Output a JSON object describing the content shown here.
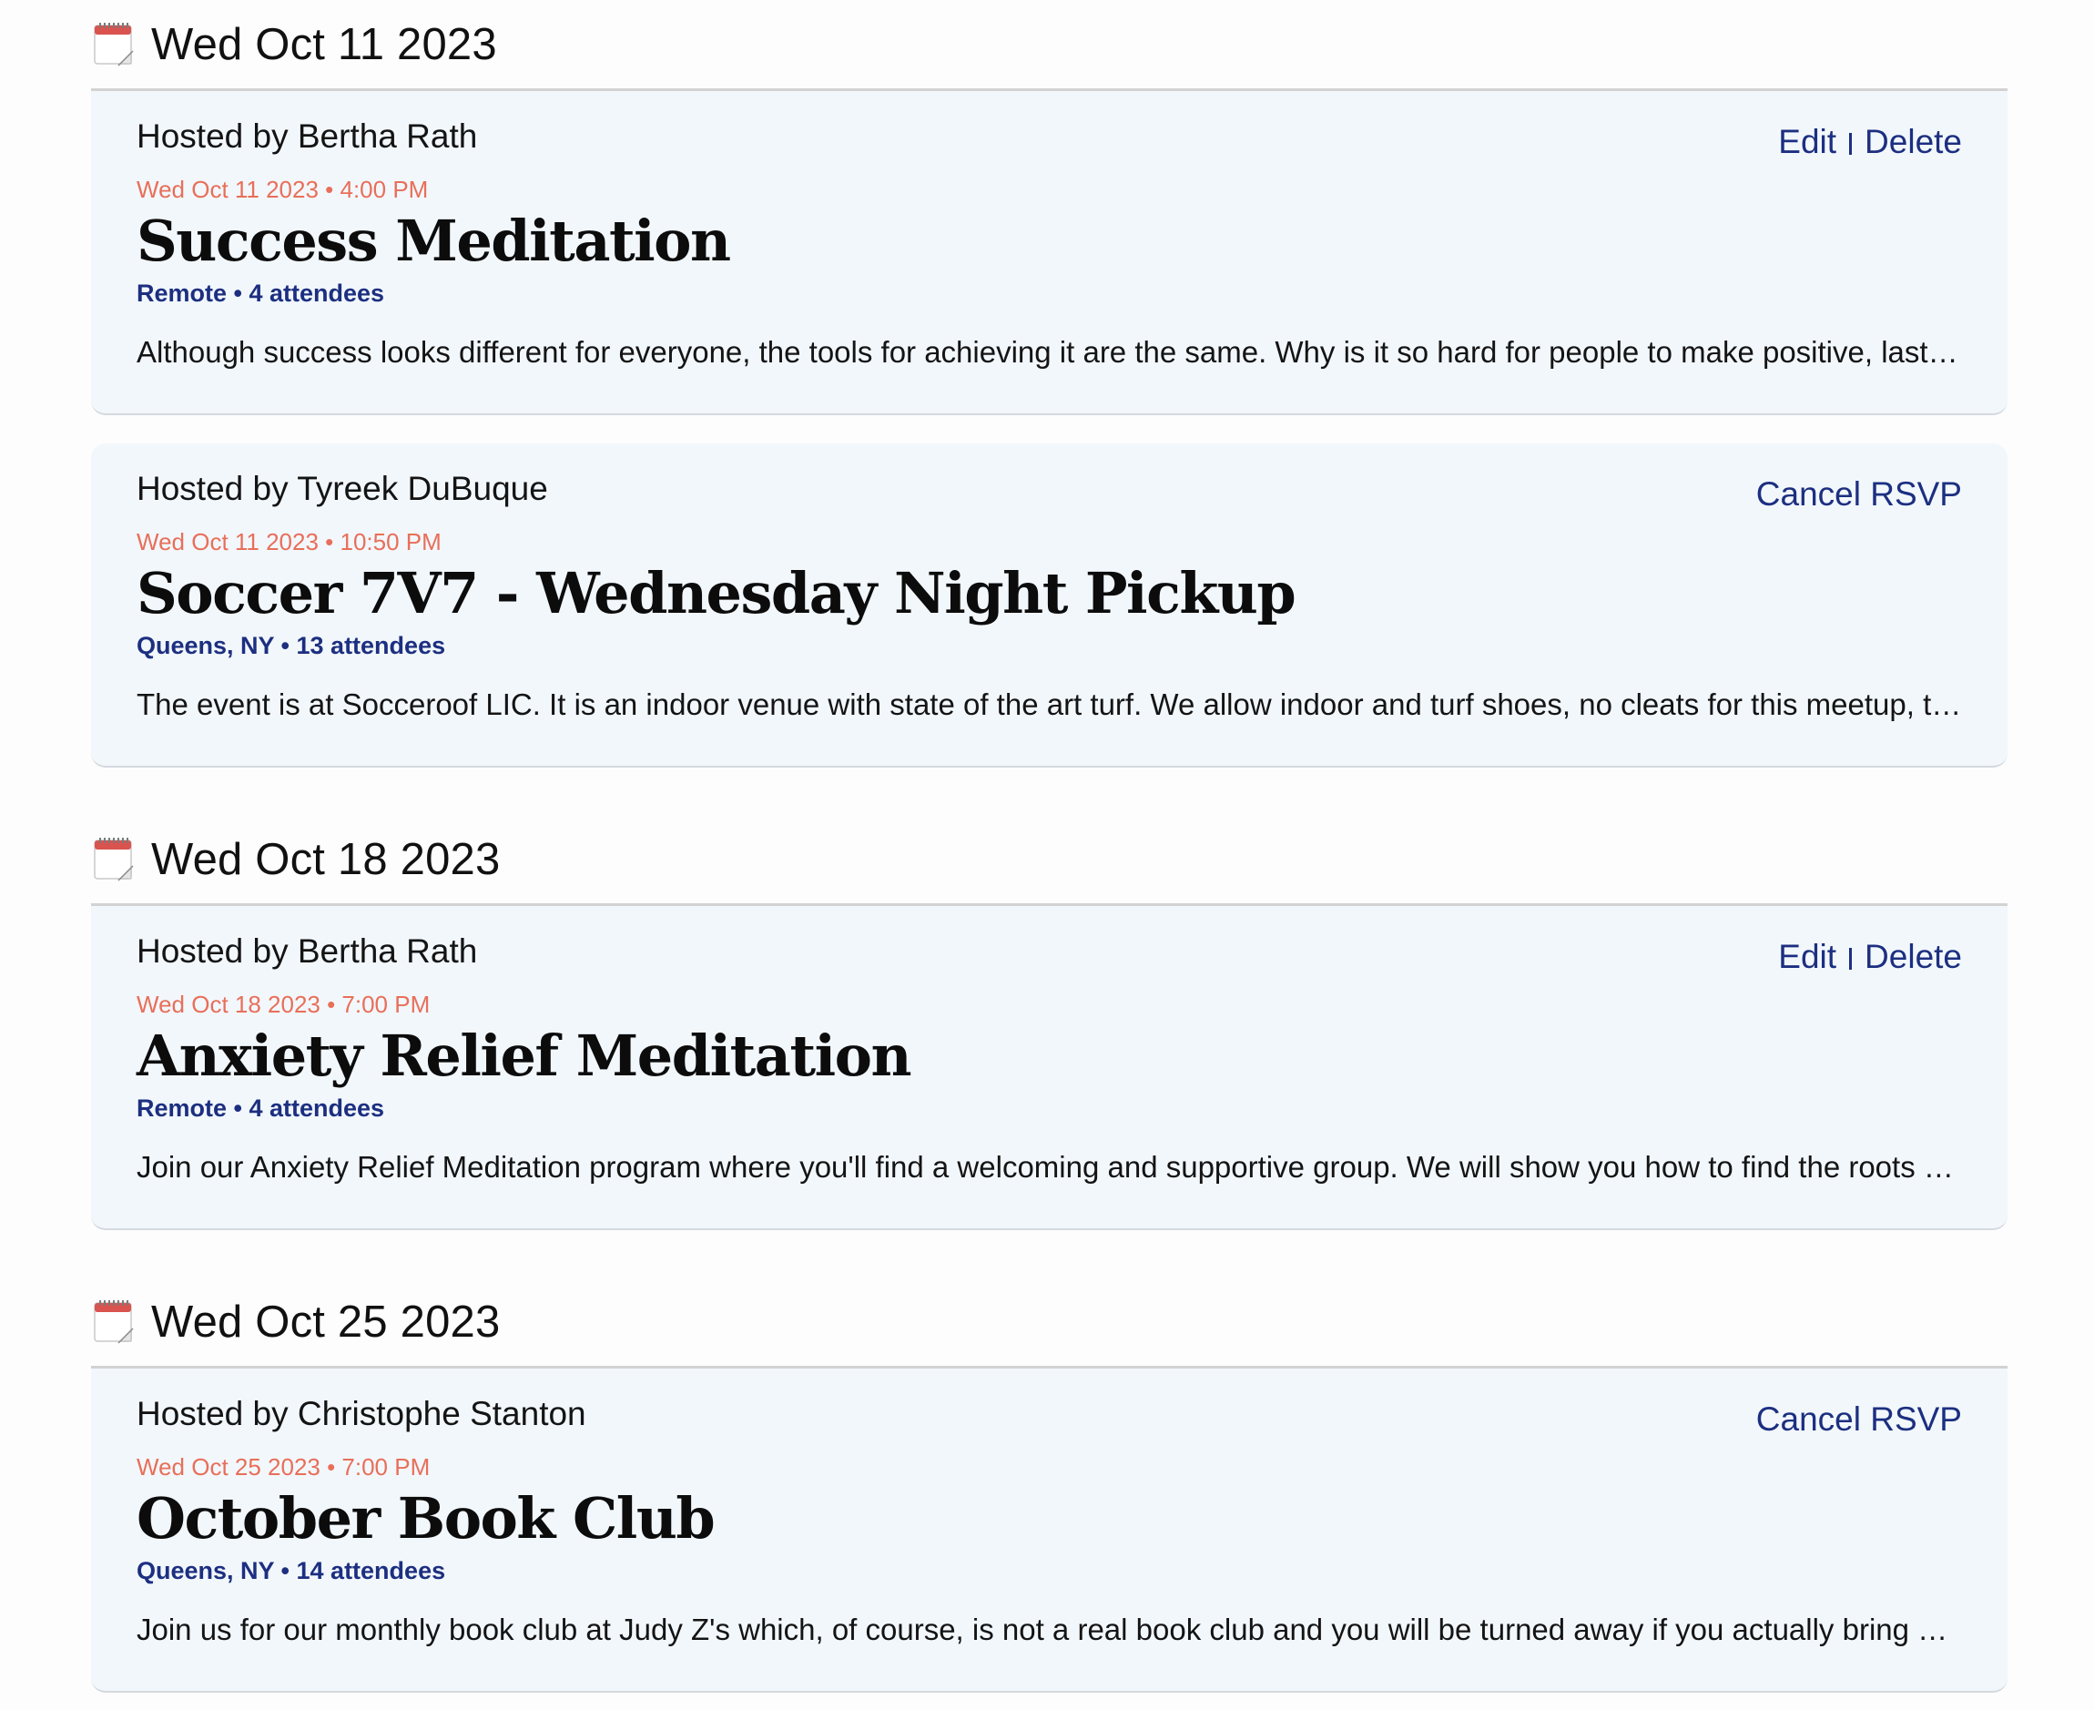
{
  "groups": [
    {
      "date_heading": "Wed Oct 11 2023",
      "events": [
        {
          "hosted_by": "Hosted by Bertha Rath",
          "actions": [
            "Edit",
            "Delete"
          ],
          "datetime": "Wed Oct 11 2023 • 4:00 PM",
          "title": "Success Meditation",
          "meta": "Remote • 4 attendees",
          "description": "Although success looks different for everyone, the tools for achieving it are the same. Why is it so hard for people to make positive, lasting changes in their lives? Join us."
        },
        {
          "hosted_by": "Hosted by Tyreek DuBuque",
          "actions": [
            "Cancel RSVP"
          ],
          "datetime": "Wed Oct 11 2023 • 10:50 PM",
          "title": "Soccer 7V7 - Wednesday Night Pickup",
          "meta": "Queens, NY • 13 attendees",
          "description": "The event is at Socceroof LIC. It is an indoor venue with state of the art turf. We allow indoor and turf shoes, no cleats for this meetup, the staff will check."
        }
      ]
    },
    {
      "date_heading": "Wed Oct 18 2023",
      "events": [
        {
          "hosted_by": "Hosted by Bertha Rath",
          "actions": [
            "Edit",
            "Delete"
          ],
          "datetime": "Wed Oct 18 2023 • 7:00 PM",
          "title": "Anxiety Relief Meditation",
          "meta": "Remote • 4 attendees",
          "description": "Join our Anxiety Relief Meditation program where you'll find a welcoming and supportive group. We will show you how to find the roots of your anxiety."
        }
      ]
    },
    {
      "date_heading": "Wed Oct 25 2023",
      "events": [
        {
          "hosted_by": "Hosted by Christophe Stanton",
          "actions": [
            "Cancel RSVP"
          ],
          "datetime": "Wed Oct 25 2023 • 7:00 PM",
          "title": "October Book Club",
          "meta": "Queens, NY • 14 attendees",
          "description": "Join us for our monthly book club at Judy Z's which, of course, is not a real book club and you will be turned away if you actually bring a book."
        }
      ]
    }
  ],
  "icons": {
    "day_header": "calendar-icon"
  }
}
